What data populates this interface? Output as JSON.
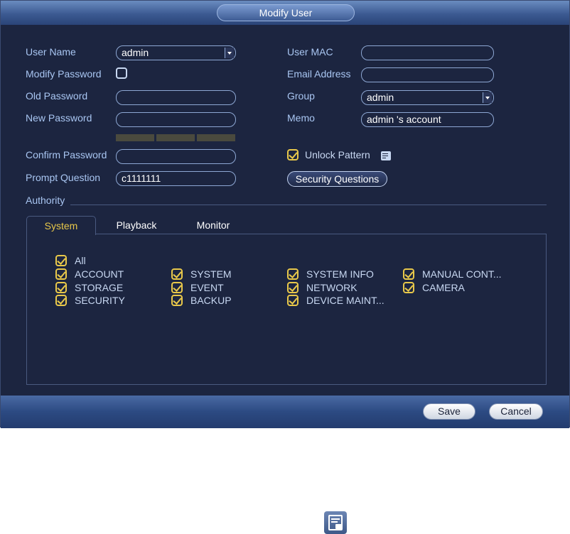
{
  "dialog": {
    "title": "Modify User"
  },
  "left_form": {
    "user_name_label": "User Name",
    "user_name_value": "admin",
    "modify_password_label": "Modify Password",
    "modify_password_checked": false,
    "old_password_label": "Old Password",
    "old_password_value": "",
    "new_password_label": "New Password",
    "new_password_value": "",
    "confirm_password_label": "Confirm Password",
    "confirm_password_value": "",
    "prompt_question_label": "Prompt Question",
    "prompt_question_value": "c1111111"
  },
  "right_form": {
    "user_mac_label": "User MAC",
    "user_mac_value": "",
    "email_label": "Email Address",
    "email_value": "",
    "group_label": "Group",
    "group_value": "admin",
    "memo_label": "Memo",
    "memo_value": "admin 's account",
    "unlock_pattern_label": "Unlock Pattern",
    "unlock_pattern_checked": true,
    "security_questions_label": "Security Questions"
  },
  "authority": {
    "section_label": "Authority",
    "tabs": [
      {
        "label": "System",
        "active": true
      },
      {
        "label": "Playback",
        "active": false
      },
      {
        "label": "Monitor",
        "active": false
      }
    ],
    "all_label": "All",
    "permissions": [
      {
        "label": "ACCOUNT",
        "checked": true
      },
      {
        "label": "SYSTEM",
        "checked": true
      },
      {
        "label": "SYSTEM INFO",
        "checked": true
      },
      {
        "label": "MANUAL CONT...",
        "checked": true
      },
      {
        "label": "STORAGE",
        "checked": true
      },
      {
        "label": "EVENT",
        "checked": true
      },
      {
        "label": "NETWORK",
        "checked": true
      },
      {
        "label": "CAMERA",
        "checked": true
      },
      {
        "label": "SECURITY",
        "checked": true
      },
      {
        "label": "BACKUP",
        "checked": true
      },
      {
        "label": "DEVICE MAINT...",
        "checked": true
      }
    ]
  },
  "footer": {
    "save_label": "Save",
    "cancel_label": "Cancel"
  },
  "colors": {
    "background": "#1c2540",
    "label": "#a9c6f2",
    "accent": "#e8c84a",
    "titlebar": "#3c5a92"
  }
}
